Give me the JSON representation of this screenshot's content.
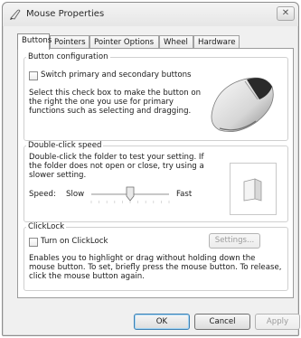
{
  "window": {
    "title": "Mouse Properties",
    "close_symbol": "✕"
  },
  "tabs": [
    {
      "label": "Buttons",
      "active": true
    },
    {
      "label": "Pointers",
      "active": false
    },
    {
      "label": "Pointer Options",
      "active": false
    },
    {
      "label": "Wheel",
      "active": false
    },
    {
      "label": "Hardware",
      "active": false
    }
  ],
  "button_config": {
    "legend": "Button configuration",
    "checkbox_label": "Switch primary and secondary buttons",
    "checked": false,
    "description": "Select this check box to make the button on the right the one you use for primary functions such as selecting and dragging."
  },
  "double_click": {
    "legend": "Double-click speed",
    "description": "Double-click the folder to test your setting. If the folder does not open or close, try using a slower setting.",
    "speed_label": "Speed:",
    "slow_label": "Slow",
    "fast_label": "Fast",
    "slider_value": 0.5
  },
  "clicklock": {
    "legend": "ClickLock",
    "checkbox_label": "Turn on ClickLock",
    "checked": false,
    "settings_button": "Settings...",
    "description": "Enables you to highlight or drag without holding down the mouse button. To set, briefly press the mouse button. To release, click the mouse button again."
  },
  "footer": {
    "ok": "OK",
    "cancel": "Cancel",
    "apply": "Apply"
  },
  "icons": {
    "title": "mouse-pointer-icon",
    "mouse": "mouse-icon",
    "folder": "folder-icon"
  },
  "colors": {
    "window_bg": "#f0f0f0",
    "panel_bg": "#ffffff",
    "default_button_border": "#3c7fb1"
  }
}
